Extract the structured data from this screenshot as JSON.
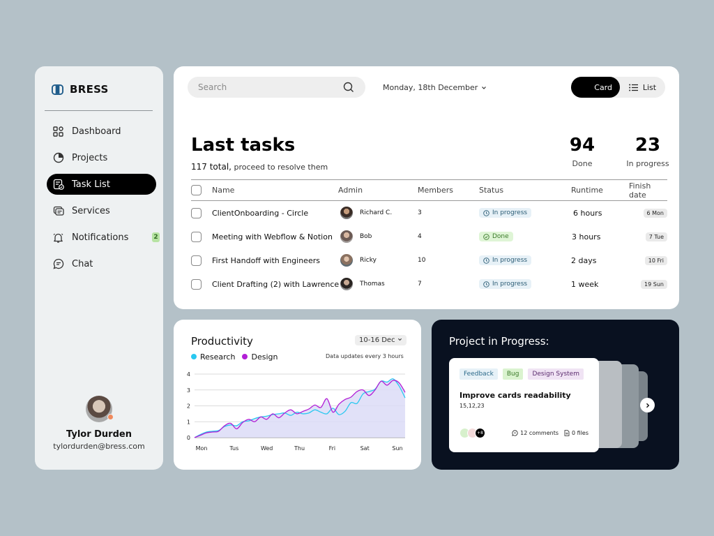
{
  "app": {
    "name": "BRESS"
  },
  "sidebar": {
    "items": [
      {
        "label": "Dashboard"
      },
      {
        "label": "Projects"
      },
      {
        "label": "Task List"
      },
      {
        "label": "Services"
      },
      {
        "label": "Notifications",
        "badge": "2"
      },
      {
        "label": "Chat"
      }
    ],
    "active": "Task List",
    "user": {
      "name": "Tylor Durden",
      "email": "tylordurden@bress.com"
    }
  },
  "header": {
    "search_placeholder": "Search",
    "date": "Monday, 18th December",
    "view_card": "Card",
    "view_list": "List",
    "view_selected": "Card"
  },
  "tasks": {
    "title": "Last tasks",
    "total": "117 total,",
    "total_suffix": "proceed to resolve them",
    "stats": [
      {
        "value": "94",
        "label": "Done"
      },
      {
        "value": "23",
        "label": "In progress"
      }
    ],
    "columns": [
      "Name",
      "Admin",
      "Members",
      "Status",
      "Runtime",
      "Finish date"
    ],
    "rows": [
      {
        "name": "ClientOnboarding - Circle",
        "admin": "Richard C.",
        "members": "3",
        "status": "In progress",
        "runtime": "6 hours",
        "finish": "6 Mon"
      },
      {
        "name": "Meeting with Webflow & Notion",
        "admin": "Bob",
        "members": "4",
        "status": "Done",
        "runtime": "3 hours",
        "finish": "7 Tue"
      },
      {
        "name": "First Handoff with Engineers",
        "admin": "Ricky",
        "members": "10",
        "status": "In progress",
        "runtime": "2  days",
        "finish": "10 Fri"
      },
      {
        "name": "Client Drafting (2) with Lawrence",
        "admin": "Thomas",
        "members": "7",
        "status": "In progress",
        "runtime": "1 week",
        "finish": "19 Sun"
      }
    ]
  },
  "productivity": {
    "title": "Productivity",
    "range": "10-16 Dec",
    "note": "Data updates every 3 hours"
  },
  "chart_data": {
    "type": "line",
    "title": "Productivity",
    "x": [
      "Mon",
      "Tus",
      "Wed",
      "Thu",
      "Fri",
      "Sat",
      "Sun"
    ],
    "ylim": [
      0,
      4
    ],
    "yticks": [
      "0",
      "1",
      "2",
      "3",
      "4"
    ],
    "grid": true,
    "legend": "top-left",
    "series": [
      {
        "name": "Research",
        "color": "#29c8f0",
        "values": [
          0.0,
          0.2,
          0.35,
          0.4,
          0.45,
          0.7,
          0.8,
          0.75,
          1.0,
          1.05,
          1.2,
          1.3,
          1.35,
          1.45,
          1.5,
          1.55,
          1.4,
          1.6,
          1.5,
          1.55,
          1.75,
          1.6,
          1.5,
          1.85,
          1.45,
          1.65,
          2.2,
          2.15,
          2.75,
          2.9,
          3.05,
          3.55,
          3.5,
          3.7,
          3.25,
          2.5
        ]
      },
      {
        "name": "Design",
        "color": "#b21fd6",
        "values": [
          0.0,
          0.15,
          0.3,
          0.35,
          0.4,
          0.75,
          0.9,
          0.55,
          0.95,
          1.15,
          1.0,
          1.3,
          1.15,
          1.5,
          1.25,
          1.55,
          1.75,
          1.5,
          1.65,
          1.8,
          2.05,
          1.9,
          2.45,
          1.6,
          2.1,
          2.4,
          2.55,
          2.9,
          3.0,
          2.65,
          3.0,
          3.55,
          3.3,
          3.6,
          3.45,
          2.85
        ]
      }
    ]
  },
  "project": {
    "title": "Project in Progress:",
    "card": {
      "tags": [
        "Feedback",
        "Bug",
        "Design System"
      ],
      "title": "Improve cards readability",
      "subtitle": "15,12,23",
      "more": "+8",
      "comments": "12 comments",
      "files": "0 files"
    }
  }
}
